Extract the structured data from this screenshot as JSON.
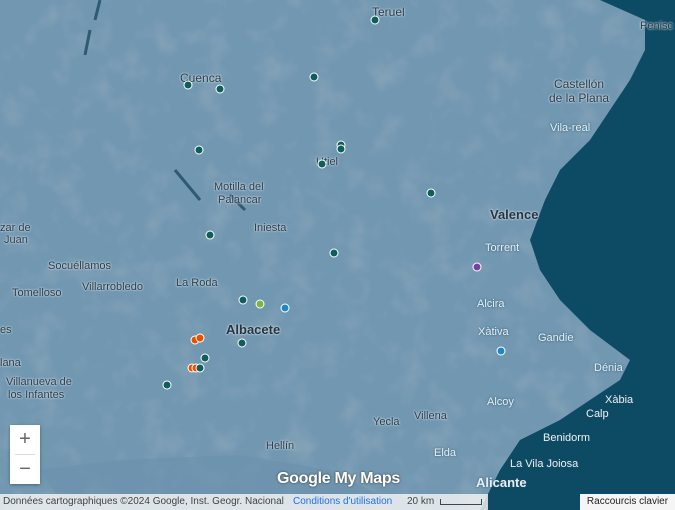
{
  "map": {
    "labels": [
      {
        "text": "Teruel",
        "cls": "med"
      },
      {
        "text": "Penisc",
        "cls": ""
      },
      {
        "text": "Cuenca",
        "cls": "med"
      },
      {
        "text": "Castellón",
        "cls": "med"
      },
      {
        "text": "de la Plana",
        "cls": "med"
      },
      {
        "text": "Vila-real",
        "cls": "light"
      },
      {
        "text": "Utiel",
        "cls": ""
      },
      {
        "text": "Motilla del",
        "cls": ""
      },
      {
        "text": "Palancar",
        "cls": ""
      },
      {
        "text": "Valence",
        "cls": "big"
      },
      {
        "text": "Torrent",
        "cls": "light"
      },
      {
        "text": "zar de",
        "cls": ""
      },
      {
        "text": "Juan",
        "cls": ""
      },
      {
        "text": "Iniesta",
        "cls": ""
      },
      {
        "text": "Socuéllamos",
        "cls": ""
      },
      {
        "text": "La Roda",
        "cls": ""
      },
      {
        "text": "Tomelloso",
        "cls": ""
      },
      {
        "text": "Villarrobledo",
        "cls": ""
      },
      {
        "text": "Alcira",
        "cls": "light"
      },
      {
        "text": "Albacete",
        "cls": "big"
      },
      {
        "text": "Xàtiva",
        "cls": "light"
      },
      {
        "text": "Gandie",
        "cls": "light"
      },
      {
        "text": "es",
        "cls": ""
      },
      {
        "text": "lana",
        "cls": ""
      },
      {
        "text": "Villanueva de",
        "cls": ""
      },
      {
        "text": "los Infantes",
        "cls": ""
      },
      {
        "text": "Dénia",
        "cls": "light"
      },
      {
        "text": "Xàbia",
        "cls": "light"
      },
      {
        "text": "Alcoy",
        "cls": "light"
      },
      {
        "text": "Calp",
        "cls": "light"
      },
      {
        "text": "Yecla",
        "cls": ""
      },
      {
        "text": "Villena",
        "cls": ""
      },
      {
        "text": "Benidorm",
        "cls": "light"
      },
      {
        "text": "Hellín",
        "cls": ""
      },
      {
        "text": "Elda",
        "cls": "light"
      },
      {
        "text": "La Vila Joiosa",
        "cls": "light"
      },
      {
        "text": "Alicante",
        "cls": "big light"
      }
    ],
    "pins": [
      {
        "color": "#0f5e5a"
      },
      {
        "color": "#0f5e5a"
      },
      {
        "color": "#0f5e5a"
      },
      {
        "color": "#0f5e5a"
      },
      {
        "color": "#0f5e5a"
      },
      {
        "color": "#0f5e5a"
      },
      {
        "color": "#0f5e5a"
      },
      {
        "color": "#0f5e5a"
      },
      {
        "color": "#0f5e5a"
      },
      {
        "color": "#0f5e5a"
      },
      {
        "color": "#0f5e5a"
      },
      {
        "color": "#7cb342"
      },
      {
        "color": "#1e88c7"
      },
      {
        "color": "#0f5e5a"
      },
      {
        "color": "#e65100"
      },
      {
        "color": "#e65100"
      },
      {
        "color": "#0f5e5a"
      },
      {
        "color": "#e65100"
      },
      {
        "color": "#e65100"
      },
      {
        "color": "#0f5e5a"
      },
      {
        "color": "#0f5e5a"
      },
      {
        "color": "#1e88c7"
      },
      {
        "color": "#7b3fa0"
      },
      {
        "color": "#0f5e5a"
      }
    ],
    "zoom_in_label": "+",
    "zoom_out_label": "−",
    "logo": "Google My Maps",
    "copyright": "Données cartographiques ©2024 Google, Inst. Geogr. Nacional",
    "terms": "Conditions d'utilisation",
    "scale": "20 km",
    "shortcuts": "Raccourcis clavier",
    "sea_color": "#0d4a63",
    "land_color": "#6f93ad"
  }
}
